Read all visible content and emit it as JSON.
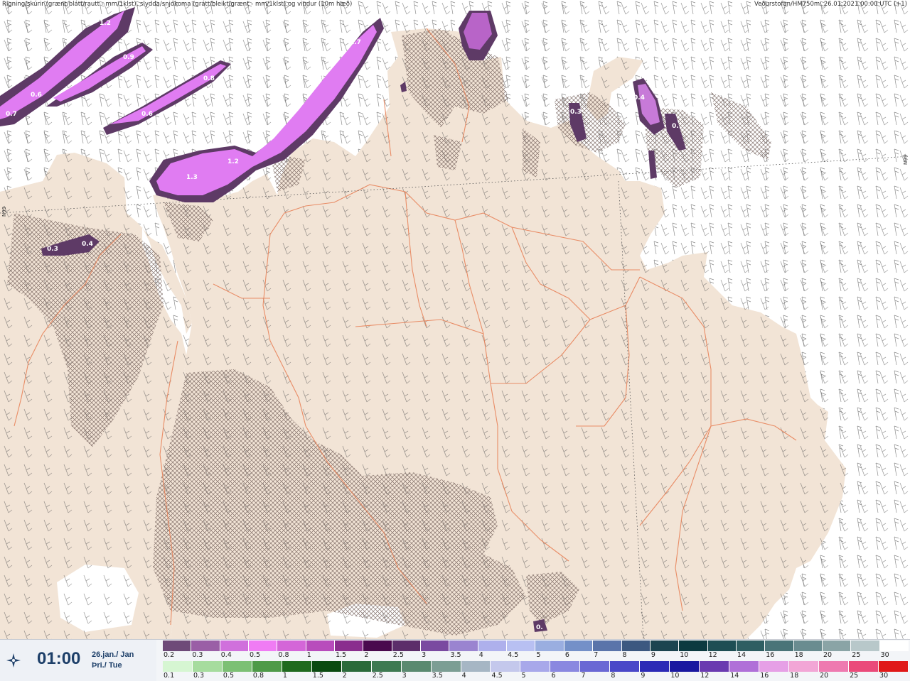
{
  "header": {
    "left": "Rigning/skúrir (grænt/blátt/rautt - mm/1klst), slydda/snjókoma (grátt/bleikt/grænt - mm/1klst) og vindur (10m hæð)",
    "right": "Veðurstofan/HM750m: 26.01.2021 00:00 UTC (+1)"
  },
  "map": {
    "latitude_label": "N99",
    "colors": {
      "land": "#f2e4d6",
      "sea": "#ffffff",
      "roads": "#e8835a",
      "precip_light": "#e07cf2",
      "precip_dark": "#5e3a66"
    },
    "contour_labels": [
      "1.2",
      "0.9",
      "0.8",
      "0.6",
      "0.7",
      "0.6",
      "1.7",
      "1.3",
      "1.2",
      "1.3",
      "0.3",
      "0.4",
      "0.3",
      "0.4",
      "0.",
      "0."
    ]
  },
  "footer": {
    "time": "01:00",
    "date_line1": "26.jan./ Jan",
    "date_line2": "Þri./ Tue",
    "icon": "compass-star-icon"
  },
  "legend": {
    "top": {
      "labels": [
        "0.2",
        "0.3",
        "0.4",
        "0.5",
        "0.8",
        "1",
        "1.5",
        "2",
        "2.5",
        "3",
        "3.5",
        "4",
        "4.5",
        "5",
        "6",
        "7",
        "8",
        "9",
        "10",
        "12",
        "14",
        "16",
        "18",
        "20",
        "25",
        "30"
      ],
      "colors": [
        "#6e4a78",
        "#9a5fa6",
        "#d070dc",
        "#f07cf4",
        "#d466d8",
        "#b84cbc",
        "#8a2e8e",
        "#4a0a4e",
        "#5c2e6a",
        "#7a4aa0",
        "#9a84d0",
        "#aeb0ec",
        "#b8c0f2",
        "#9aaee0",
        "#7490c8",
        "#5a74aa",
        "#3c5880",
        "#1c4450",
        "#0c3a40",
        "#1e4e54",
        "#2e5e62",
        "#4a7478",
        "#6a8c90",
        "#8aa4a6",
        "#b8c8ca",
        "#ffffff"
      ]
    },
    "bottom": {
      "labels": [
        "0.1",
        "0.3",
        "0.5",
        "0.8",
        "1",
        "1.5",
        "2",
        "2.5",
        "3",
        "3.5",
        "4",
        "4.5",
        "5",
        "6",
        "7",
        "8",
        "9",
        "10",
        "12",
        "14",
        "16",
        "18",
        "20",
        "25",
        "30"
      ],
      "colors": [
        "#d6f6d2",
        "#a6dc9e",
        "#7cc074",
        "#4e9a48",
        "#1f6a1e",
        "#0a4a10",
        "#2a6a3a",
        "#3e7a52",
        "#5a8a70",
        "#7c9e94",
        "#a6b6c4",
        "#c4c8ec",
        "#a8a8ea",
        "#8a88e0",
        "#6a68d4",
        "#4a48c8",
        "#2c2ab6",
        "#1a18a0",
        "#6a3ab0",
        "#b070d8",
        "#e6a0e6",
        "#f2a6d6",
        "#ee7ab0",
        "#ea4a7a",
        "#e01818"
      ]
    }
  }
}
